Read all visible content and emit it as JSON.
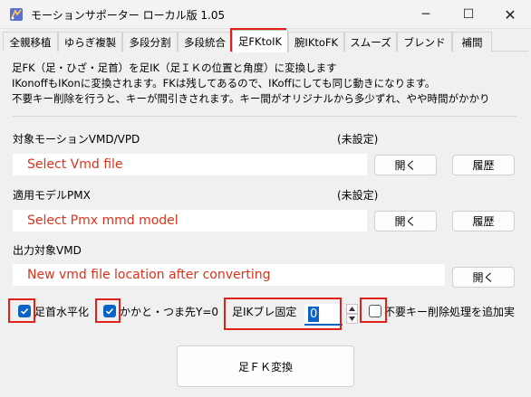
{
  "window": {
    "title": "モーションサポーター ローカル版 1.05",
    "minimize_glyph": "─",
    "maximize_glyph": "☐",
    "close_glyph": "✕"
  },
  "tabs": [
    {
      "label": "全親移植"
    },
    {
      "label": "ゆらぎ複製"
    },
    {
      "label": "多段分割"
    },
    {
      "label": "多段統合"
    },
    {
      "label": "足FKtoIK"
    },
    {
      "label": "腕IKtoFK"
    },
    {
      "label": "スムーズ"
    },
    {
      "label": "ブレンド"
    },
    {
      "label": "補間"
    }
  ],
  "description": {
    "line1": "足FK（足・ひざ・足首）を足IK（足ＩＫの位置と角度）に変換します",
    "line2": "IKonoffもIKonに変換されます。FKは残してあるので、IKoffにしても同じ動きになります。",
    "line3": "不要キー削除を行うと、キーが間引きされます。キー間がオリジナルから多少ずれ、やや時間がかかり"
  },
  "motion_section": {
    "label": "対象モーションVMD/VPD",
    "status": "(未設定)",
    "input_value": "Select Vmd file",
    "open_label": "開く",
    "history_label": "履歴"
  },
  "model_section": {
    "label": "適用モデルPMX",
    "status": "(未設定)",
    "input_value": "Select Pmx mmd model",
    "open_label": "開く",
    "history_label": "履歴"
  },
  "output_section": {
    "label": "出力対象VMD",
    "input_value": "New vmd file location after converting",
    "open_label": "開く"
  },
  "options": {
    "ankle_horizontal_label": "足首水平化",
    "ankle_horizontal_checked": true,
    "heel_toe_label": "かかと・つま先Y=0",
    "heel_toe_checked": true,
    "ik_fix_label": "足IKブレ固定",
    "ik_fix_value": "0",
    "remove_keys_label": "不要キー削除処理を追加実",
    "remove_keys_checked": false
  },
  "actions": {
    "convert_label": "足ＦＫ変換"
  },
  "colors": {
    "accent": "#0a64c8",
    "highlight_red": "#e0211a",
    "input_text_red": "#e0311a"
  }
}
